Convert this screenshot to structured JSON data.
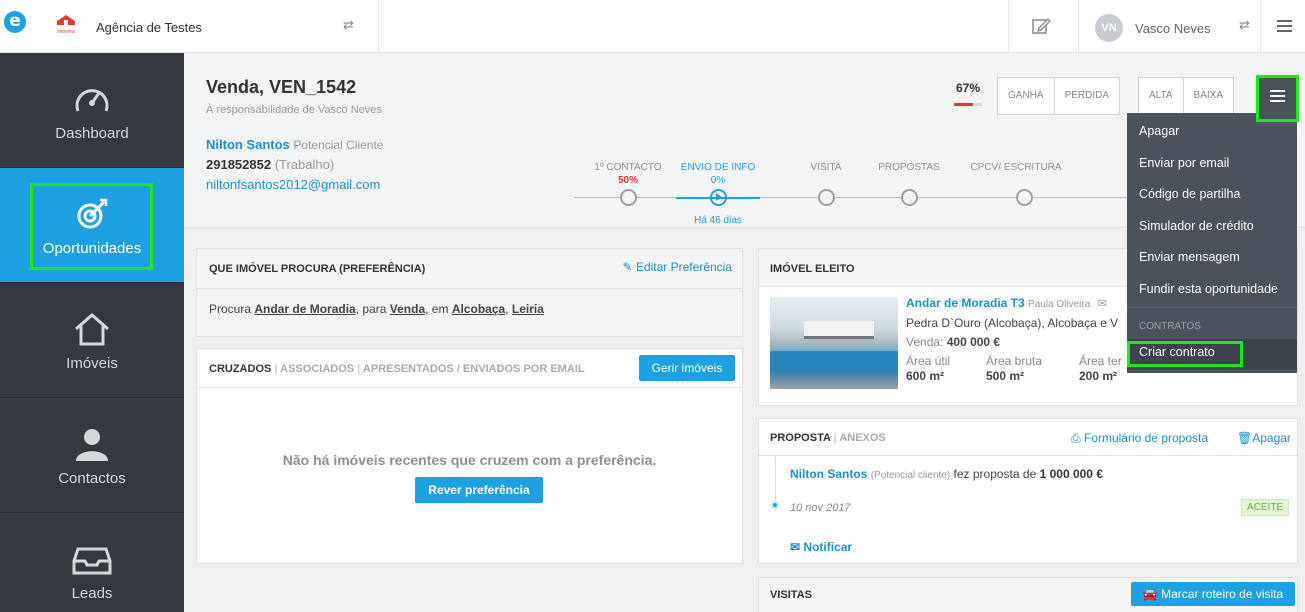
{
  "topbar": {
    "logo_letter": "e",
    "agency_logo_text": "imosma",
    "agency_name": "Agência de Testes",
    "user_initials": "VN",
    "user_name": "Vasco Neves"
  },
  "sidebar": {
    "items": [
      {
        "label": "Dashboard",
        "icon": "speedometer-icon"
      },
      {
        "label": "Oportunidades",
        "icon": "target-icon"
      },
      {
        "label": "Imóveis",
        "icon": "house-icon"
      },
      {
        "label": "Contactos",
        "icon": "person-icon"
      },
      {
        "label": "Leads",
        "icon": "inbox-icon"
      }
    ]
  },
  "header": {
    "title": "Venda, VEN_1542",
    "responsible": "À responsabilidade de Vasco Neves",
    "client_name": "Nilton Santos",
    "client_status": "Potencial Cliente",
    "phone": "291852852",
    "phone_type": "(Trabalho)",
    "email": "niltonfsantos2012@gmail.com",
    "probability": "67%",
    "probability_value": 0.67,
    "btn_ganha": "GANHA",
    "btn_perdida": "PERDIDA",
    "btn_alta": "ALTA",
    "btn_baixa": "BAIXA",
    "stages": [
      {
        "label": "1º CONTACTO",
        "pct": "50%"
      },
      {
        "label": "ENVIO DE INFO",
        "pct": "0%"
      },
      {
        "label": "VISITA"
      },
      {
        "label": "PROPOSTAS"
      },
      {
        "label": "CPCV/ ESCRITURA"
      }
    ],
    "stage_elapsed": "Há 46 dias"
  },
  "preference": {
    "title": "QUE IMÓVEL PROCURA (PREFERÊNCIA)",
    "edit_label": "Editar Preferência",
    "text_prefix": "Procura",
    "type": "Andar de Moradia",
    "sep_para": ", para",
    "deal": "Venda",
    "sep_em": ", em",
    "place1": "Alcobaça",
    "sep_comma": ",",
    "place2": "Leiria"
  },
  "cruzados": {
    "tab1": "CRUZADOS",
    "tab2": "ASSOCIADOS",
    "tab3": "APRESENTADOS / ENVIADOS POR EMAIL",
    "manage_btn": "Gerir imóveis",
    "empty_msg": "Não há imóveis recentes que cruzem com a preferência.",
    "review_btn": "Rever preferência"
  },
  "imovel": {
    "title": "IMÓVEL ELEITO",
    "name": "Andar de Moradia T3",
    "agent": "Paula Oliveira",
    "location": "Pedra D`Ouro (Alcobaça), Alcobaça e V",
    "price_label": "Venda:",
    "price": "400 000 €",
    "area_util_label": "Área útil",
    "area_util": "600 m²",
    "area_bruta_label": "Área bruta",
    "area_bruta": "500 m²",
    "area_ter_label": "Área ter",
    "area_ter": "200 m²"
  },
  "proposta": {
    "tab1": "PROPOSTA",
    "tab2": "ANEXOS",
    "form_link": "Formulário de proposta",
    "delete_link": "Apagar",
    "client": "Nilton Santos",
    "client_status": "(Potencial cliente)",
    "text": "fez proposta de",
    "amount": "1 000 000 €",
    "date": "10 nov 2017",
    "status": "ACEITE",
    "notify": "Notificar"
  },
  "visitas": {
    "title": "VISITAS",
    "btn": "Marcar roteiro de visita"
  },
  "menu": {
    "items": [
      "Apagar",
      "Enviar por email",
      "Código de partilha",
      "Simulador de crédito",
      "Enviar mensagem",
      "Fundir esta oportunidade"
    ],
    "section": "CONTRATOS",
    "contract_item": "Criar contrato"
  },
  "colors": {
    "accent": "#1da1e2",
    "sidebar": "#34393f",
    "highlight": "#1fe61f",
    "probability_bar": "#e3342f",
    "menu_bg": "#4b525b"
  }
}
